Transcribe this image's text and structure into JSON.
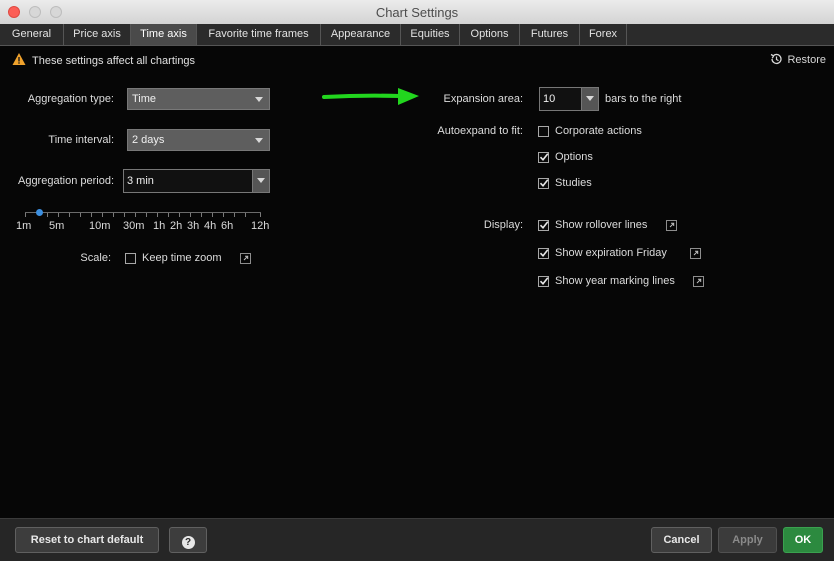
{
  "window": {
    "title": "Chart Settings"
  },
  "tabs": [
    "General",
    "Price axis",
    "Time axis",
    "Favorite time frames",
    "Appearance",
    "Equities",
    "Options",
    "Futures",
    "Forex"
  ],
  "active_tab": "Time axis",
  "notice": {
    "text": "These settings affect all chartings",
    "icon": "warning-icon"
  },
  "restore": {
    "label": "Restore",
    "icon": "restore-icon"
  },
  "left": {
    "aggregation_type": {
      "label": "Aggregation type:",
      "value": "Time"
    },
    "time_interval": {
      "label": "Time interval:",
      "value": "2 days"
    },
    "aggregation_period": {
      "label": "Aggregation period:",
      "value": "3 min"
    },
    "slider": {
      "labels": [
        "1m",
        "5m",
        "10m",
        "30m",
        "1h",
        "2h",
        "3h",
        "4h",
        "6h",
        "12h"
      ],
      "selected": "3 min"
    },
    "scale": {
      "label": "Scale:",
      "checkbox_label": "Keep time zoom",
      "checked": false
    }
  },
  "right": {
    "expansion": {
      "label": "Expansion area:",
      "value": "10",
      "suffix": "bars to the right"
    },
    "autoexpand": {
      "label": "Autoexpand to fit:",
      "items": [
        {
          "label": "Corporate actions",
          "checked": false
        },
        {
          "label": "Options",
          "checked": true
        },
        {
          "label": "Studies",
          "checked": true
        }
      ]
    },
    "display": {
      "label": "Display:",
      "items": [
        {
          "label": "Show rollover lines",
          "checked": true
        },
        {
          "label": "Show expiration Friday",
          "checked": true
        },
        {
          "label": "Show year marking lines",
          "checked": true
        }
      ]
    }
  },
  "annotation": {
    "arrow_color": "#22d61e"
  },
  "footer": {
    "reset": "Reset to chart default",
    "help": "?",
    "cancel": "Cancel",
    "apply": "Apply",
    "ok": "OK"
  },
  "colors": {
    "ok_green": "#2c8a3f",
    "slider_thumb": "#3c8fe0",
    "warning": "#f0a22c"
  }
}
